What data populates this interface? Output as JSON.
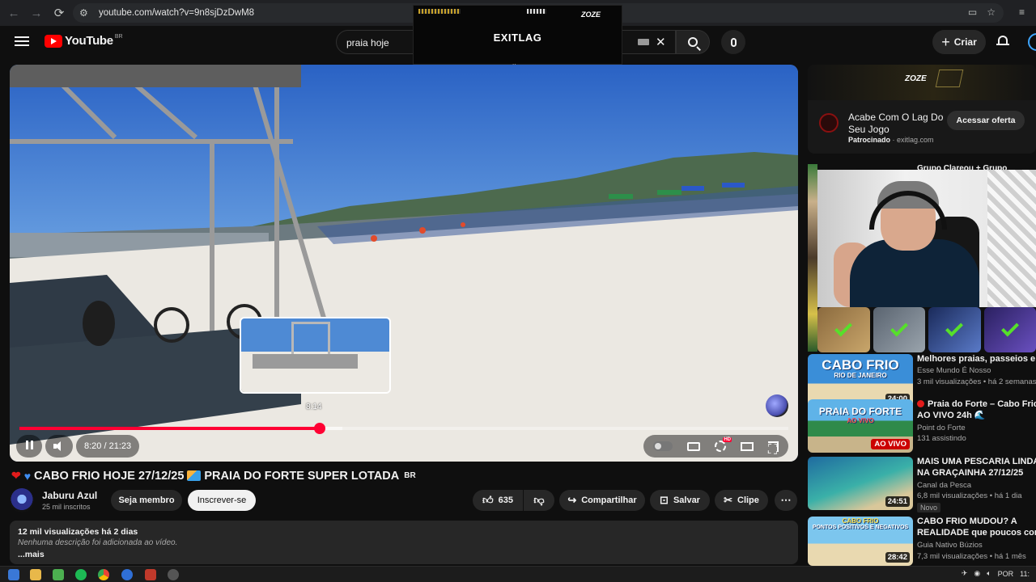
{
  "browser": {
    "url": "youtube.com/watch?v=9n8sjDzDwM8",
    "nav": {
      "back": "←",
      "forward": "→",
      "reload": "⟳"
    }
  },
  "header": {
    "logo_text": "YouTube",
    "country_code": "BR",
    "search_query": "praia hoje",
    "create_label": "Criar"
  },
  "overlay": {
    "brand": "EXITLAG",
    "sponsor_tag": "ZOZE",
    "dots": ".."
  },
  "player": {
    "preview_time": "8:14",
    "time_display": "8:20 / 21:23",
    "progress_fraction": 0.391,
    "loaded_fraction": 0.42
  },
  "video": {
    "title": "CABO FRIO HOJE 27/12/25",
    "title_part2": "PRAIA DO FORTE SUPER LOTADA",
    "title_suffix": "BR",
    "channel_name": "Jaburu Azul",
    "subscribers": "25 mil inscritos",
    "member_label": "Seja membro",
    "subscribe_label": "Inscrever-se",
    "likes": "635",
    "share_label": "Compartilhar",
    "save_label": "Salvar",
    "clip_label": "Clipe",
    "meta": "12 mil visualizações  há 2 dias",
    "description": "Nenhuma descrição foi adicionada ao vídeo.",
    "more_label": "...mais"
  },
  "ad": {
    "banner_tag": "ZOZE",
    "title": "Acabe Com O Lag Do Seu Jogo",
    "sponsored_label": "Patrocinado",
    "domain": "exitlag.com",
    "cta": "Acessar oferta"
  },
  "sidebar": {
    "peek_title": "Grupo Clareou + Grupo",
    "recommendations": [
      {
        "title": "Melhores praias, passeios e ...",
        "channel": "Esse Mundo É Nosso",
        "views": "3 mil visualizações • há 2 semanas",
        "duration": "24:00",
        "thumb_title": "CABO FRIO",
        "thumb_sub": "RIO DE JANEIRO"
      },
      {
        "title_line1": "Praia do Forte – Cabo Frio",
        "title_line2": "AO VIVO 24h 🌊",
        "channel": "Point do Forte",
        "views": "131 assistindo",
        "live_badge": "AO VIVO",
        "thumb_title": "PRAIA DO FORTE",
        "thumb_sub": "AO VIVO"
      },
      {
        "title_line1": "MAIS UMA PESCARIA LINDA",
        "title_line2": "NA GRAÇAINHA 27/12/25",
        "channel": "Canal da Pesca",
        "views": "6,8 mil visualizações • há 1 dia",
        "badge": "Novo",
        "duration": "24:51"
      },
      {
        "title_line1": "CABO FRIO MUDOU? A",
        "title_line2": "REALIDADE que poucos contam",
        "channel": "Guia Nativo Búzios",
        "views": "7,3 mil visualizações • há 1 mês",
        "duration": "28:42",
        "thumb_title": "CABO FRIO",
        "thumb_sub": "PONTOS POSITIVOS E NEGATIVOS"
      }
    ]
  },
  "taskbar": {
    "lang": "POR",
    "clock": "11:"
  },
  "colors": {
    "accent_red": "#ff0033",
    "background": "#0f0f0f",
    "chip": "#272727"
  }
}
